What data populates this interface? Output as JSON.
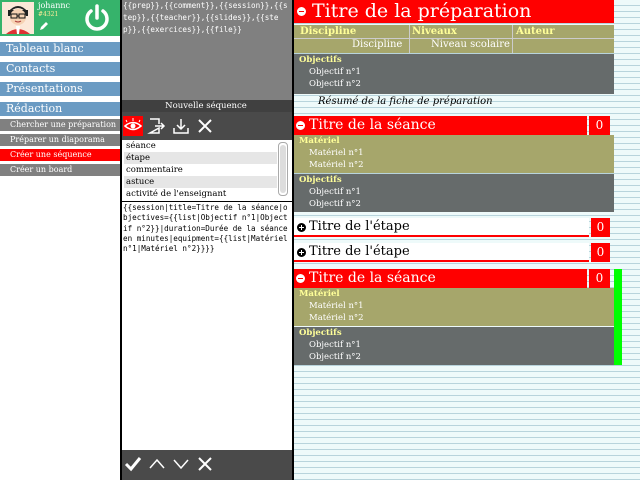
{
  "user": {
    "name": "johannc",
    "id": "#4321",
    "avatar_icon": "person-avatar-icon",
    "power_icon": "power-icon"
  },
  "menu": {
    "items": [
      {
        "label": "Tableau blanc"
      },
      {
        "label": "Contacts"
      },
      {
        "label": "Présentations"
      },
      {
        "label": "Rédaction"
      }
    ],
    "sub_items": [
      {
        "label": "Chercher une préparation",
        "active": false
      },
      {
        "label": "Préparer un diaporama",
        "active": false
      },
      {
        "label": "Créer une séquence",
        "active": true
      },
      {
        "label": "Créer un board",
        "active": false
      }
    ]
  },
  "editor": {
    "templates": "{{prep}},{{comment}},{{session}},{{step}},{{teacher}},{{slides}},{{step}},{{exercices}},{{file}}",
    "new_sequence_label": "Nouvelle séquence",
    "elements": [
      "séance",
      "étape",
      "commentaire",
      "astuce",
      "activité de l'enseignant"
    ],
    "code": "{{session|title=Titre de la séance|objectives={{list|Objectif n°1|Objectif n°2}}|duration=Durée de la séance en minutes|equipment={{list|Matériel n°1|Matériel n°2}}}}"
  },
  "preview": {
    "title": "Titre de la préparation",
    "table_headers": [
      "Discipline",
      "Niveaux",
      "Auteur"
    ],
    "table_values": [
      "Discipline",
      "Niveau scolaire",
      ""
    ],
    "objectifs_label": "Objectifs",
    "objectifs": [
      "Objectif n°1",
      "Objectif n°2"
    ],
    "summary": "Résumé de la fiche de préparation",
    "sessions": [
      {
        "title": "Titre de la séance",
        "count": "0",
        "materiel_label": "Matériel",
        "materiel": [
          "Matériel n°1",
          "Matériel n°2"
        ],
        "objectifs_label": "Objectifs",
        "objectifs": [
          "Objectif n°1",
          "Objectif n°2"
        ]
      },
      {
        "title": "Titre de la séance",
        "count": "0",
        "materiel_label": "Matériel",
        "materiel": [
          "Matériel n°1",
          "Matériel n°2"
        ],
        "objectifs_label": "Objectifs",
        "objectifs": [
          "Objectif n°1",
          "Objectif n°2"
        ]
      }
    ],
    "steps": [
      {
        "title": "Titre de l'étape",
        "count": "0"
      },
      {
        "title": "Titre de l'étape",
        "count": "0"
      }
    ]
  },
  "colors": {
    "accent": "#ff0000",
    "user_bar": "#36b36b",
    "menu": "#6b9bc3",
    "submenu": "#808080",
    "olive": "#a6a66b",
    "dark": "#666b6b",
    "selected_indicator": "#00ff00"
  }
}
